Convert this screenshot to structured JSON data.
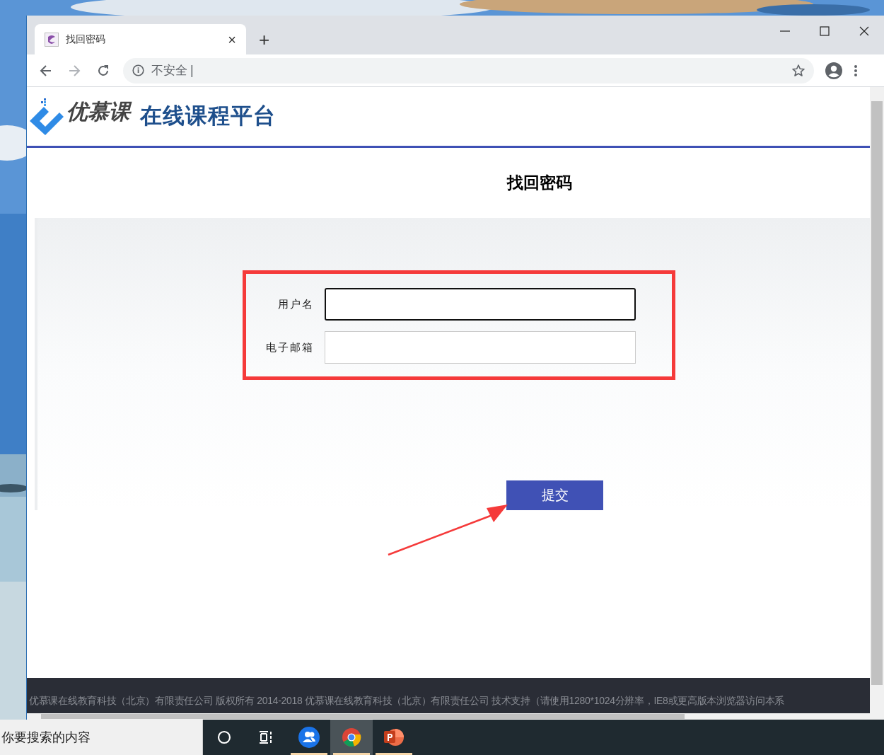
{
  "browser": {
    "tab": {
      "title": "找回密码",
      "close": "×",
      "new_tab": "+"
    },
    "address_bar": {
      "security_label": "不安全",
      "separator": "|"
    }
  },
  "page": {
    "logo": {
      "brand": "优慕课",
      "subtitle": "在线课程平台"
    },
    "title": "找回密码",
    "form": {
      "fields": [
        {
          "label": "用户名",
          "focused": true
        },
        {
          "label": "电子邮箱",
          "focused": false
        }
      ],
      "submit": "提交"
    },
    "footer": "优慕课在线教育科技（北京）有限责任公司 版权所有 2014-2018 优慕课在线教育科技（北京）有限责任公司 技术支持（请使用1280*1024分辨率，IE8或更高版本浏览器访问本系"
  },
  "taskbar": {
    "search_placeholder": "你要搜索的内容",
    "apps": [
      {
        "kind": "people",
        "selected": false,
        "running": true
      },
      {
        "kind": "chrome",
        "selected": true,
        "running": true
      },
      {
        "kind": "powerpoint",
        "selected": false,
        "running": true
      }
    ]
  }
}
